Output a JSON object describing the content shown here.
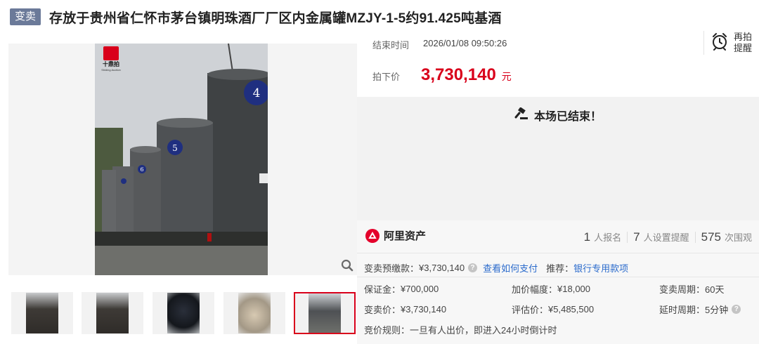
{
  "header": {
    "badge": "变卖",
    "title": "存放于贵州省仁怀市茅台镇明珠酒厂厂区内金属罐MZJY-1-5约91.425吨基酒"
  },
  "gallery": {
    "logo_text": "十鼎拍",
    "logo_sub": "Shiding Auction",
    "tank_numbers": [
      "4",
      "5",
      "6",
      "4"
    ]
  },
  "auction": {
    "end_label": "结束时间",
    "end_time": "2026/01/08 09:50:26",
    "price_label": "拍下价",
    "price_value": "3,730,140",
    "price_unit": "元",
    "remind_label": "再拍提醒",
    "ended_message": "本场已结束！"
  },
  "stats": {
    "brand": "阿里资产",
    "signups_num": "1",
    "signups_label": "人报名",
    "reminders_num": "7",
    "reminders_label": "人设置提醒",
    "views_num": "575",
    "views_label": "次围观"
  },
  "details": {
    "deposit_label": "变卖预缴款：",
    "deposit_value": "¥3,730,140",
    "how_to_pay": "查看如何支付",
    "recommend_label": "推荐：",
    "bank_loan": "银行专用款项",
    "security_label": "保证金：",
    "security_value": "¥700,000",
    "increment_label": "加价幅度：",
    "increment_value": "¥18,000",
    "period_label": "变卖周期：",
    "period_value": "60天",
    "sale_price_label": "变卖价：",
    "sale_price_value": "¥3,730,140",
    "appraisal_label": "评估价：",
    "appraisal_value": "¥5,485,500",
    "delay_label": "延时周期：",
    "delay_value": "5分钟",
    "rule_label": "竞价规则：",
    "rule_value": "一旦有人出价，即进入24小时倒计时"
  },
  "colors": {
    "accent_red": "#d9001b",
    "link_blue": "#2b6bcc",
    "badge_bg": "#6b7a99"
  }
}
